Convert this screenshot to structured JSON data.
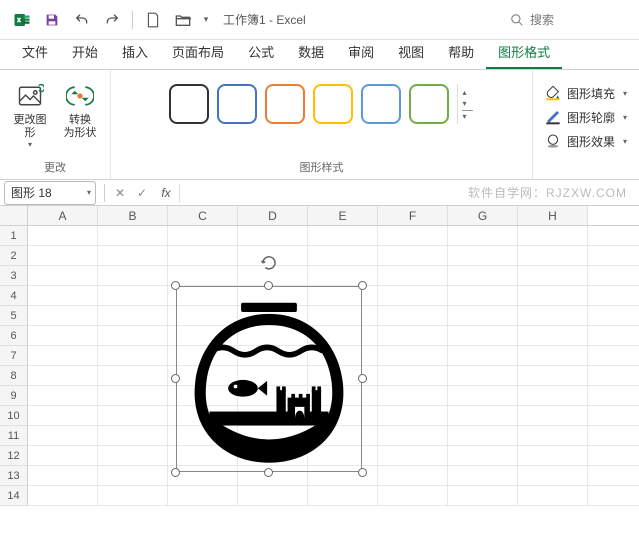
{
  "app": {
    "title": "工作簿1 - Excel"
  },
  "search": {
    "placeholder": "搜索"
  },
  "tabs": {
    "items": [
      "文件",
      "开始",
      "插入",
      "页面布局",
      "公式",
      "数据",
      "审阅",
      "视图",
      "帮助",
      "图形格式"
    ],
    "active_index": 9
  },
  "ribbon": {
    "group_change": {
      "label": "更改",
      "change_shape": "更改图\n形",
      "convert": "转换\n为形状"
    },
    "group_styles": {
      "label": "图形样式"
    },
    "group_fill": {
      "fill": "图形填充",
      "outline": "图形轮廓",
      "effects": "图形效果"
    }
  },
  "namebox": {
    "value": "图形 18",
    "fx": "fx"
  },
  "watermark": "软件自学网：RJZXW.COM",
  "columns": [
    "A",
    "B",
    "C",
    "D",
    "E",
    "F",
    "G",
    "H"
  ],
  "rows": [
    "1",
    "2",
    "3",
    "4",
    "5",
    "6",
    "7",
    "8",
    "9",
    "10",
    "11",
    "12",
    "13",
    "14"
  ],
  "style_colors": [
    "#333333",
    "#4472c4",
    "#ed7d31",
    "#ffc000",
    "#5b9bd5",
    "#70ad47"
  ]
}
